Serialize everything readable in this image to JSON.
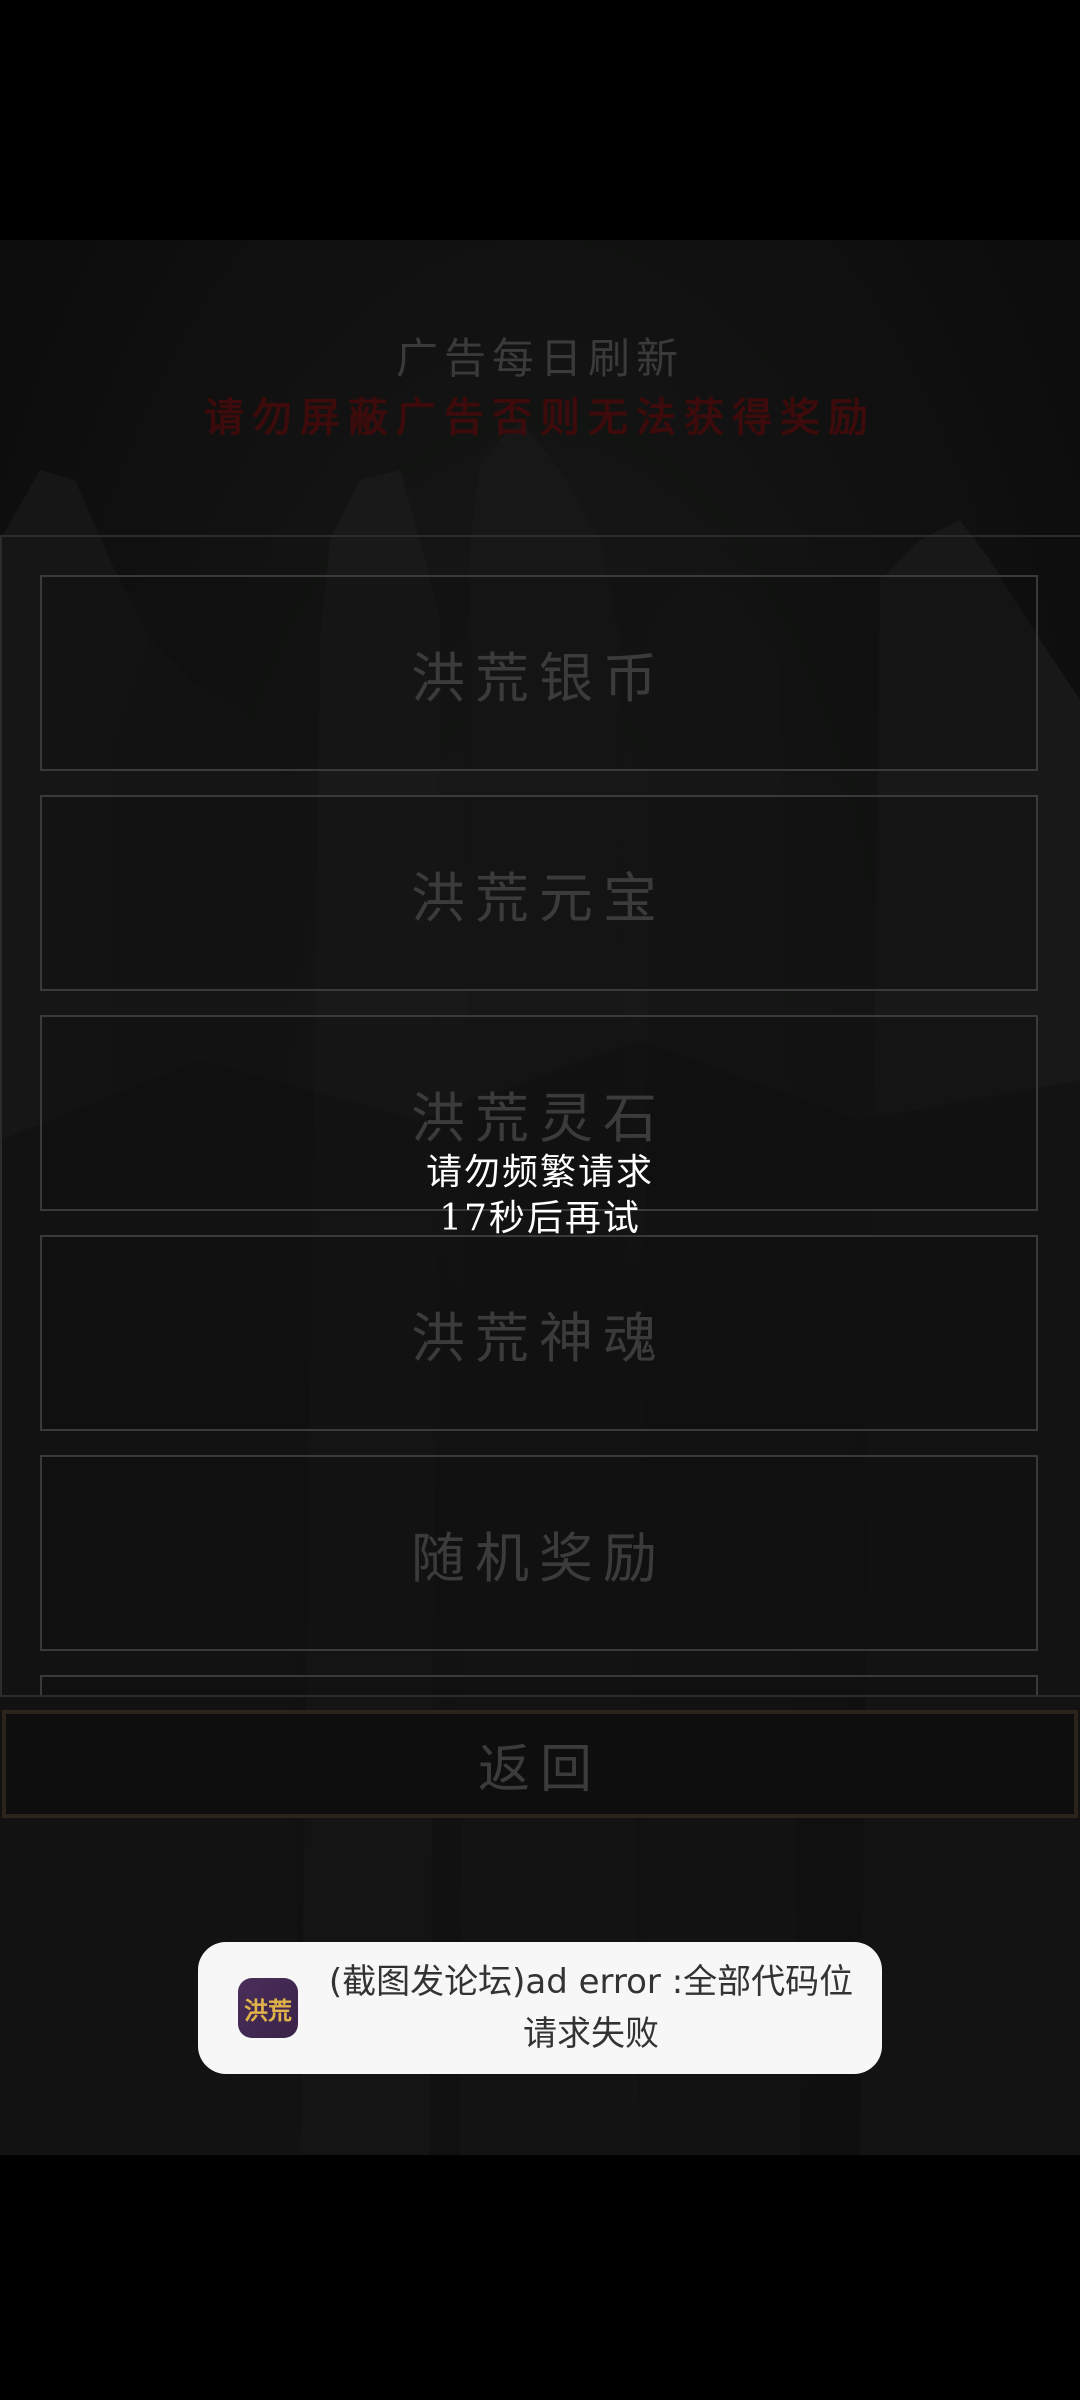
{
  "header": {
    "title": "广告每日刷新",
    "warning": "请勿屏蔽广告否则无法获得奖励"
  },
  "rewards": [
    {
      "label": "洪荒银币"
    },
    {
      "label": "洪荒元宝"
    },
    {
      "label": "洪荒灵石"
    },
    {
      "label": "洪荒神魂"
    },
    {
      "label": "随机奖励"
    }
  ],
  "back_button": {
    "label": "返回"
  },
  "message": {
    "line1": "请勿频繁请求",
    "line2": "17秒后再试"
  },
  "toast": {
    "icon_text": "洪荒",
    "text": "(截图发论坛)ad error :全部代码位请求失败"
  },
  "colors": {
    "warning": "#3d0b0b",
    "toast_bg": "#f7f7f7",
    "icon_bg": "#4a2f5a",
    "icon_text": "#e0b24a"
  }
}
